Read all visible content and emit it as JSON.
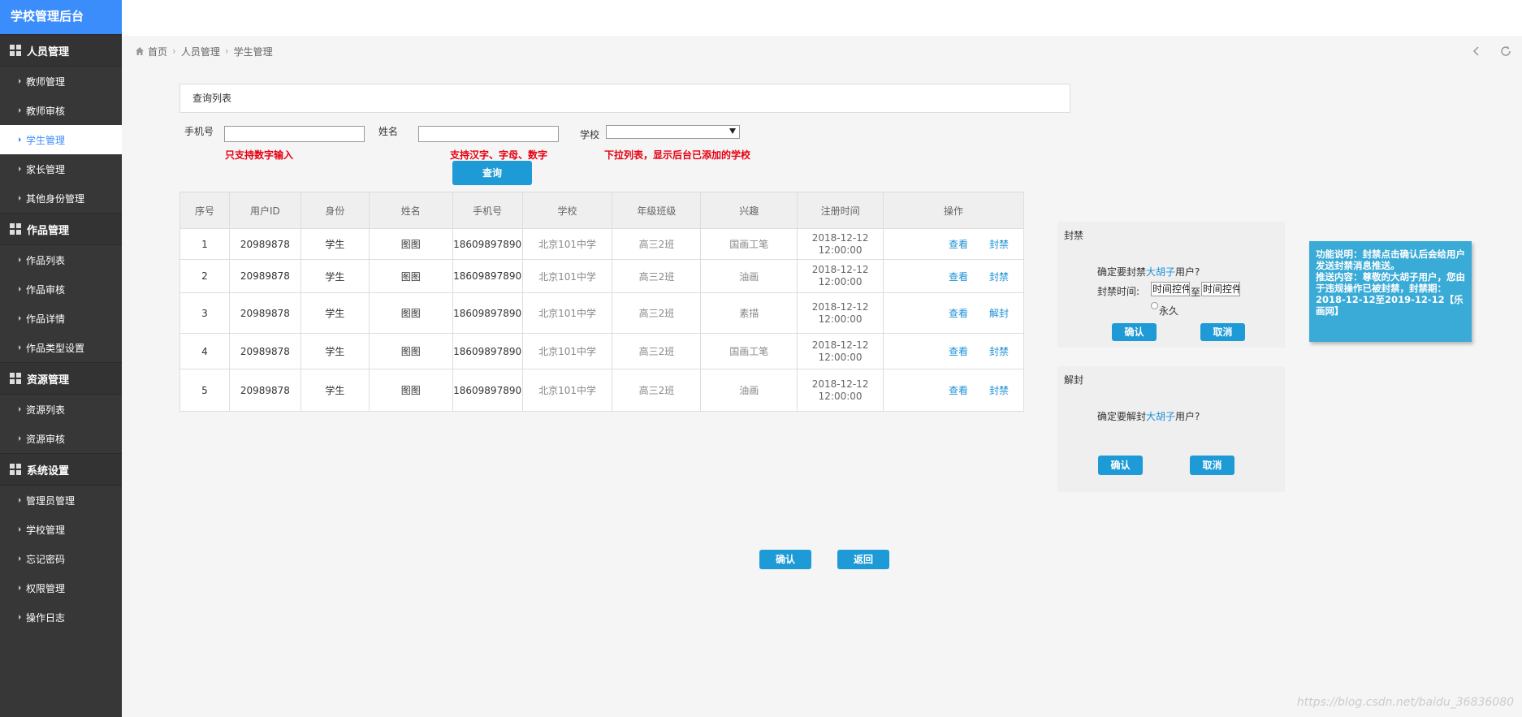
{
  "app": {
    "title": "学校管理后台"
  },
  "sidebar": {
    "groups": [
      {
        "label": "人员管理",
        "items": [
          {
            "label": "教师管理"
          },
          {
            "label": "教师审核"
          },
          {
            "label": "学生管理",
            "active": true
          },
          {
            "label": "家长管理"
          },
          {
            "label": "其他身份管理"
          }
        ]
      },
      {
        "label": "作品管理",
        "items": [
          {
            "label": "作品列表"
          },
          {
            "label": "作品审核"
          },
          {
            "label": "作品详情"
          },
          {
            "label": "作品类型设置"
          }
        ]
      },
      {
        "label": "资源管理",
        "items": [
          {
            "label": "资源列表"
          },
          {
            "label": "资源审核"
          }
        ]
      },
      {
        "label": "系统设置",
        "items": [
          {
            "label": "管理员管理"
          },
          {
            "label": "学校管理"
          },
          {
            "label": "忘记密码"
          },
          {
            "label": "权限管理"
          },
          {
            "label": "操作日志"
          }
        ]
      }
    ]
  },
  "breadcrumb": {
    "home": "首页",
    "level1": "人员管理",
    "level2": "学生管理"
  },
  "panel": {
    "title": "查询列表"
  },
  "filters": {
    "phone_label": "手机号",
    "phone_value": "",
    "phone_hint": "只支持数字输入",
    "name_label": "姓名",
    "name_value": "",
    "name_hint": "支持汉字、字母、数字",
    "school_label": "学校",
    "school_value": "",
    "school_hint": "下拉列表，显示后台已添加的学校",
    "search_label": "查询"
  },
  "table": {
    "columns": [
      "序号",
      "用户ID",
      "身份",
      "姓名",
      "手机号",
      "学校",
      "年级班级",
      "兴趣",
      "注册时间",
      "操作"
    ],
    "rows": [
      {
        "no": "1",
        "id": "20989878",
        "role": "学生",
        "name": "图图",
        "phone": "18609897890",
        "school": "北京101中学",
        "grade": "高三2班",
        "interest": "国画工笔",
        "date": "2018-12-12",
        "time": "12:00:00",
        "view": "查看",
        "action": "封禁"
      },
      {
        "no": "2",
        "id": "20989878",
        "role": "学生",
        "name": "图图",
        "phone": "18609897890",
        "school": "北京101中学",
        "grade": "高三2班",
        "interest": "油画",
        "date": "2018-12-12",
        "time": "12:00:00",
        "view": "查看",
        "action": "封禁"
      },
      {
        "no": "3",
        "id": "20989878",
        "role": "学生",
        "name": "图图",
        "phone": "18609897890",
        "school": "北京101中学",
        "grade": "高三2班",
        "interest": "素描",
        "date": "2018-12-12",
        "time": "12:00:00",
        "view": "查看",
        "action": "解封"
      },
      {
        "no": "4",
        "id": "20989878",
        "role": "学生",
        "name": "图图",
        "phone": "18609897890",
        "school": "北京101中学",
        "grade": "高三2班",
        "interest": "国画工笔",
        "date": "2018-12-12",
        "time": "12:00:00",
        "view": "查看",
        "action": "封禁"
      },
      {
        "no": "5",
        "id": "20989878",
        "role": "学生",
        "name": "图图",
        "phone": "18609897890",
        "school": "北京101中学",
        "grade": "高三2班",
        "interest": "油画",
        "date": "2018-12-12",
        "time": "12:00:00",
        "view": "查看",
        "action": "封禁"
      }
    ]
  },
  "ban_dialog": {
    "title": "封禁",
    "prompt_prefix": "确定要封禁",
    "user": "大胡子",
    "prompt_suffix": "用户?",
    "time_label": "封禁时间:",
    "start_placeholder": "时间控件",
    "to_text": "至",
    "end_placeholder": "时间控件",
    "forever_label": "永久",
    "confirm_label": "确认",
    "cancel_label": "取消"
  },
  "unban_dialog": {
    "title": "解封",
    "prompt_prefix": "确定要解封",
    "user": "大胡子",
    "prompt_suffix": "用户?",
    "confirm_label": "确认",
    "cancel_label": "取消"
  },
  "note": {
    "line1": "功能说明：封禁点击确认后会给用户发送封禁消息推送。",
    "line2": "推送内容：尊敬的大胡子用户，您由于违规操作已被封禁，封禁期：2018-12-12至2019-12-12【乐画网】"
  },
  "footer": {
    "confirm_label": "确认",
    "back_label": "返回"
  },
  "watermark": "https://blog.csdn.net/baidu_36836080",
  "colors": {
    "brand": "#3c8dfc",
    "button": "#1e9ad6",
    "hint": "#e60012",
    "note_bg": "#3aaad7",
    "sidebar_bg": "#373737"
  }
}
